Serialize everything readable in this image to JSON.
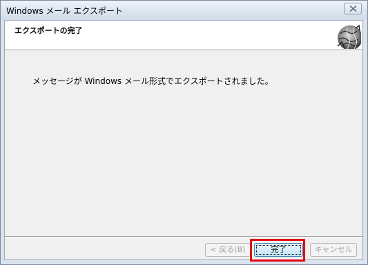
{
  "window": {
    "title": "Windows メール エクスポート"
  },
  "header": {
    "title": "エクスポートの完了"
  },
  "main": {
    "message": "メッセージが Windows メール形式でエクスポートされました。"
  },
  "buttons": {
    "back_label": "< 戻る(B)",
    "finish_label": "完了",
    "cancel_label": "キャンセル"
  },
  "icons": {
    "close": "close-icon",
    "header_art": "globe-icon"
  },
  "colors": {
    "highlight": "#e60012",
    "title_bar": "#dbe5ef",
    "dialog_bg": "#f0f0f0"
  }
}
